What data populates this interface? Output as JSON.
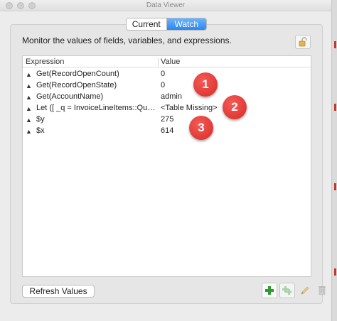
{
  "window": {
    "title": "Data Viewer"
  },
  "tabs": {
    "current_label": "Current",
    "watch_label": "Watch",
    "selected": "Watch"
  },
  "description": "Monitor the values of fields, variables, and expressions.",
  "table": {
    "headers": {
      "expression": "Expression",
      "value": "Value"
    },
    "rows": [
      {
        "expression": "Get(RecordOpenCount)",
        "value": "0"
      },
      {
        "expression": "Get(RecordOpenState)",
        "value": "0"
      },
      {
        "expression": "Get(AccountName)",
        "value": "admin"
      },
      {
        "expression": "Let ([ _q = InvoiceLineItems::Quantity...",
        "value": "<Table Missing>"
      },
      {
        "expression": "$y",
        "value": "275"
      },
      {
        "expression": "$x",
        "value": "614"
      }
    ]
  },
  "callouts": [
    "1",
    "2",
    "3"
  ],
  "buttons": {
    "refresh": "Refresh Values"
  },
  "icons": {
    "row_grip": "sort-arrows-icon",
    "lock": "padlock-icon",
    "add": "plus-icon",
    "duplicate": "duplicate-plus-icon",
    "edit": "pencil-icon",
    "delete": "trash-icon"
  },
  "colors": {
    "accent": "#2a87f0",
    "callout": "#e0322e",
    "add_icon": "#2e9b2e"
  }
}
